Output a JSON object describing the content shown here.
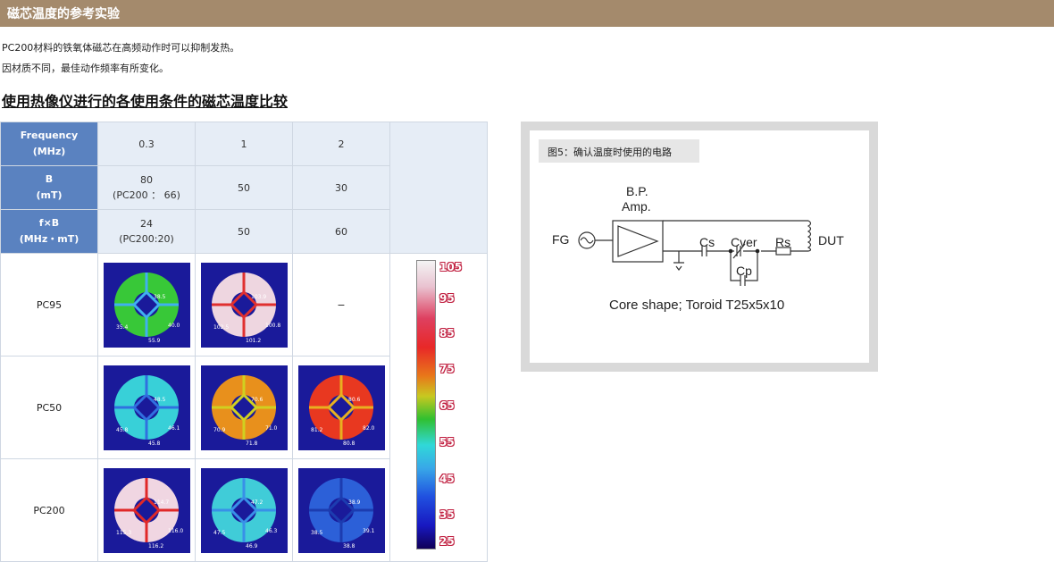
{
  "header": {
    "title": "磁芯温度的参考实验"
  },
  "intro": {
    "line1": "PC200材料的铁氧体磁芯在高频动作时可以抑制发热。",
    "line2": "因材质不同，最佳动作频率有所变化。"
  },
  "section_title": "使用热像仪进行的各使用条件的磁芯温度比较",
  "table": {
    "freq_label": "Frequency",
    "freq_unit": "(MHz)",
    "freq_values": [
      "0.3",
      "1",
      "2"
    ],
    "b_label": "B",
    "b_unit": "(mT)",
    "b_v1": "80",
    "b_v1_note": "(PC200 ： 66)",
    "b_v2": "50",
    "b_v3": "30",
    "fb_label": "f×B",
    "fb_unit": "(MHz・mT)",
    "fb_v1": "24",
    "fb_v1_note": "(PC200:20)",
    "fb_v2": "50",
    "fb_v3": "60",
    "rows": [
      {
        "material": "PC95",
        "cells": [
          {
            "temps": [
              "38.5",
              "35.4",
              "40.0",
              "55.9"
            ]
          },
          {
            "temps": [
              "103.9",
              "102.5",
              "100.8",
              "101.2"
            ]
          },
          {
            "text": "−"
          }
        ]
      },
      {
        "material": "PC50",
        "cells": [
          {
            "temps": [
              "48.5",
              "45.8",
              "46.1",
              "45.8"
            ]
          },
          {
            "temps": [
              "70.6",
              "70.9",
              "71.0",
              "71.8"
            ]
          },
          {
            "temps": [
              "80.6",
              "81.2",
              "82.0",
              "80.8"
            ]
          }
        ]
      },
      {
        "material": "PC200",
        "cells": [
          {
            "temps": [
              "114.7",
              "115.3",
              "116.0",
              "116.2"
            ]
          },
          {
            "temps": [
              "47.2",
              "47.5",
              "46.3",
              "46.9"
            ]
          },
          {
            "temps": [
              "38.9",
              "38.5",
              "39.1",
              "38.8"
            ]
          }
        ]
      }
    ]
  },
  "scale_labels": [
    "105",
    "95",
    "85",
    "75",
    "65",
    "55",
    "45",
    "35",
    "25"
  ],
  "figure": {
    "caption": "图5：确认温度时使用的电路",
    "amp_label_1": "B.P.",
    "amp_label_2": "Amp.",
    "fg": "FG",
    "cs": "Cs",
    "cver": "Cver",
    "rs": "Rs",
    "dut": "DUT",
    "cp": "Cp",
    "core_shape": "Core shape; Toroid T25x5x10"
  }
}
